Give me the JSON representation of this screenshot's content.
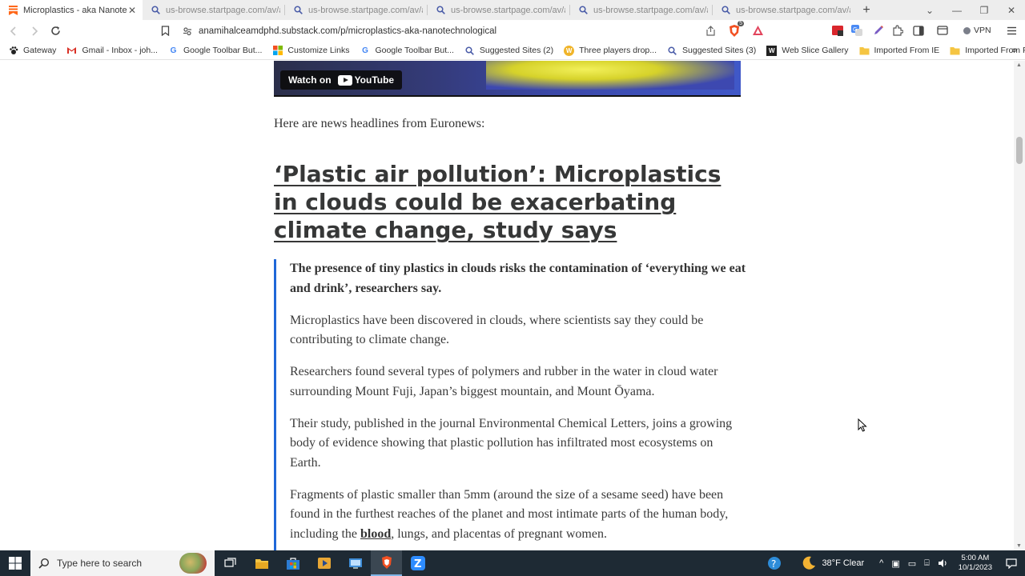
{
  "browser": {
    "tabs": [
      {
        "label": "Microplastics - aka Nanotechn",
        "active": true,
        "icon": "substack-icon"
      },
      {
        "label": "us-browse.startpage.com/av/anon",
        "active": false,
        "icon": "startpage-search-icon"
      },
      {
        "label": "us-browse.startpage.com/av/anon",
        "active": false,
        "icon": "startpage-search-icon"
      },
      {
        "label": "us-browse.startpage.com/av/anon",
        "active": false,
        "icon": "startpage-search-icon"
      },
      {
        "label": "us-browse.startpage.com/av/anon",
        "active": false,
        "icon": "startpage-search-icon"
      },
      {
        "label": "us-browse.startpage.com/av/anon",
        "active": false,
        "icon": "startpage-search-icon"
      }
    ],
    "url": "anamihalceamdphd.substack.com/p/microplastics-aka-nanotechnological",
    "vpn_label": "VPN",
    "brave_badge": "5",
    "bookmarks": [
      {
        "label": "Gateway",
        "icon": "paw-icon"
      },
      {
        "label": "Gmail - Inbox - joh...",
        "icon": "gmail-icon"
      },
      {
        "label": "Google Toolbar But...",
        "icon": "google-icon"
      },
      {
        "label": "Customize Links",
        "icon": "windows-icon"
      },
      {
        "label": "Google Toolbar But...",
        "icon": "google-icon"
      },
      {
        "label": "Suggested Sites (2)",
        "icon": "search-icon"
      },
      {
        "label": "Three players drop...",
        "icon": "yahoo-icon"
      },
      {
        "label": "Suggested Sites (3)",
        "icon": "search-icon"
      },
      {
        "label": "Web Slice Gallery",
        "icon": "webslice-icon"
      },
      {
        "label": "Imported From IE",
        "icon": "folder-icon"
      },
      {
        "label": "Imported From Fire...",
        "icon": "folder-icon"
      }
    ]
  },
  "article": {
    "video_watch_label": "Watch on",
    "video_youtube_label": "YouTube",
    "intro": "Here are news headlines from Euronews:",
    "headline": "‘Plastic air pollution’: Microplastics in clouds could be exacerbating climate change, study says",
    "quote": {
      "lead": "The presence of tiny plastics in clouds risks the contamination of ‘everything we eat and drink’, researchers say.",
      "p1": "Microplastics have been discovered in clouds, where scientists say they could be contributing to climate change.",
      "p2": "Researchers found several types of polymers and rubber in the water in cloud water surrounding Mount Fuji, Japan’s biggest mountain, and Mount Ōyama.",
      "p3": "Their study, published in the journal Environmental Chemical Letters, joins a growing body of evidence showing that plastic pollution has infiltrated most ecosystems on Earth.",
      "p4_before": "Fragments of plastic smaller than 5mm (around the size of a sesame seed) have been found in the furthest reaches of the planet and most intimate parts of the human body, including the ",
      "p4_link": "blood",
      "p4_after": ", lungs, and placentas of pregnant women."
    }
  },
  "taskbar": {
    "search_placeholder": "Type here to search",
    "weather": "38°F  Clear",
    "time": "5:00 AM",
    "date": "10/1/2023"
  },
  "colors": {
    "accent_border": "#1f67d8",
    "taskbar_bg": "#1e2a34"
  }
}
